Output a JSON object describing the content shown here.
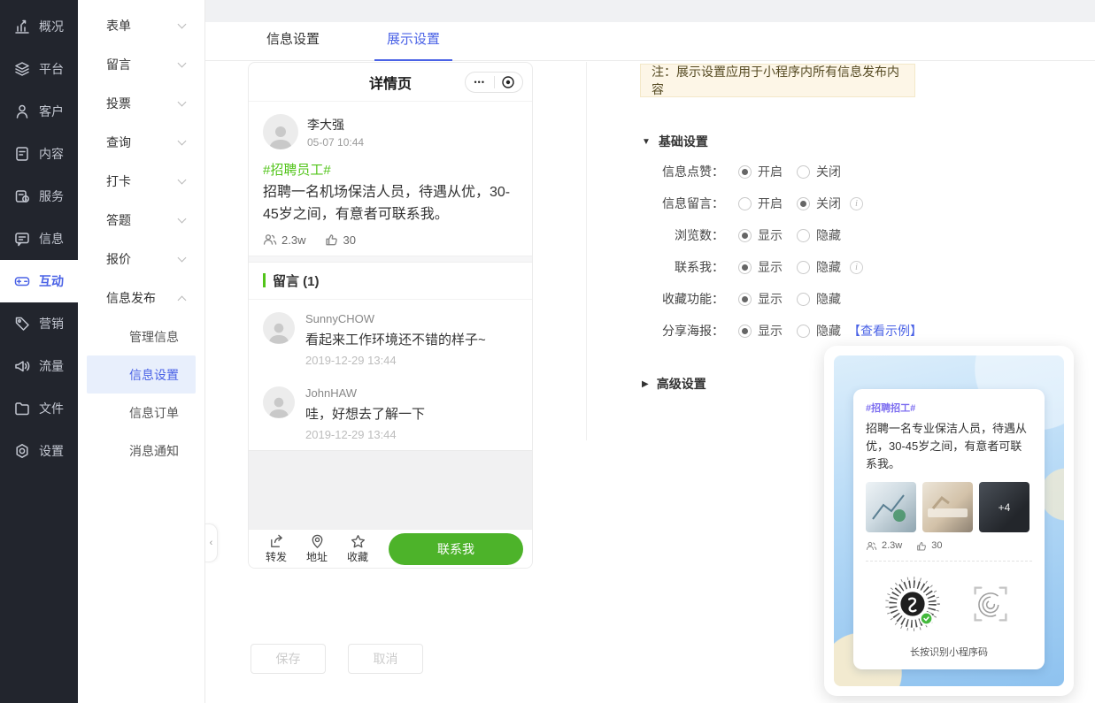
{
  "colors": {
    "accent": "#4a62e6",
    "wechat_green": "#4db32a",
    "tag_green": "#52c41a",
    "poster_purple": "#7d6ef0",
    "note_bg": "#fdf6e7"
  },
  "sidebar": {
    "items": [
      {
        "label": "概况",
        "icon": "overview-icon",
        "active": false
      },
      {
        "label": "平台",
        "icon": "platform-icon",
        "active": false
      },
      {
        "label": "客户",
        "icon": "customers-icon",
        "active": false
      },
      {
        "label": "内容",
        "icon": "content-icon",
        "active": false
      },
      {
        "label": "服务",
        "icon": "services-icon",
        "active": false
      },
      {
        "label": "信息",
        "icon": "messages-icon",
        "active": false
      },
      {
        "label": "互动",
        "icon": "interaction-icon",
        "active": true
      },
      {
        "label": "营销",
        "icon": "marketing-icon",
        "active": false
      },
      {
        "label": "流量",
        "icon": "traffic-icon",
        "active": false
      },
      {
        "label": "文件",
        "icon": "files-icon",
        "active": false
      },
      {
        "label": "设置",
        "icon": "settings-icon",
        "active": false
      }
    ]
  },
  "submenu": {
    "items": [
      {
        "label": "表单"
      },
      {
        "label": "留言"
      },
      {
        "label": "投票"
      },
      {
        "label": "查询"
      },
      {
        "label": "打卡"
      },
      {
        "label": "答题"
      },
      {
        "label": "报价"
      },
      {
        "label": "信息发布",
        "expanded": true
      }
    ],
    "children": [
      {
        "label": "管理信息",
        "selected": false
      },
      {
        "label": "信息设置",
        "selected": true
      },
      {
        "label": "信息订单",
        "selected": false
      },
      {
        "label": "消息通知",
        "selected": false
      }
    ]
  },
  "tabs": [
    {
      "label": "信息设置",
      "active": false
    },
    {
      "label": "展示设置",
      "active": true
    }
  ],
  "preview": {
    "title": "详情页",
    "capsule_dots": "•••",
    "post": {
      "name": "李大强",
      "time": "05-07 10:44",
      "tag": "#招聘员工#",
      "text": "招聘一名机场保洁人员，待遇从优，30-45岁之间，有意者可联系我。",
      "views": "2.3w",
      "likes": "30"
    },
    "comments_title": "留言 (1)",
    "comments": [
      {
        "name": "SunnyCHOW",
        "text": "看起来工作环境还不错的样子~",
        "time": "2019-12-29 13:44"
      },
      {
        "name": "JohnHAW",
        "text": "哇，好想去了解一下",
        "time": "2019-12-29 13:44"
      }
    ],
    "footer": {
      "actions": [
        {
          "label": "转发",
          "icon": "forward-icon"
        },
        {
          "label": "地址",
          "icon": "location-icon"
        },
        {
          "label": "收藏",
          "icon": "star-icon"
        }
      ],
      "contact_button": "联系我"
    }
  },
  "settings": {
    "note": "注：展示设置应用于小程序内所有信息发布内容",
    "basic_title": "基础设置",
    "advanced_title": "高级设置",
    "rows": [
      {
        "label": "信息点赞：",
        "options": [
          {
            "text": "开启",
            "selected": true
          },
          {
            "text": "关闭",
            "selected": false
          }
        ],
        "info": false
      },
      {
        "label": "信息留言：",
        "options": [
          {
            "text": "开启",
            "selected": false
          },
          {
            "text": "关闭",
            "selected": true
          }
        ],
        "info": true
      },
      {
        "label": "浏览数：",
        "options": [
          {
            "text": "显示",
            "selected": true
          },
          {
            "text": "隐藏",
            "selected": false
          }
        ],
        "info": false
      },
      {
        "label": "联系我：",
        "options": [
          {
            "text": "显示",
            "selected": true
          },
          {
            "text": "隐藏",
            "selected": false
          }
        ],
        "info": true
      },
      {
        "label": "收藏功能：",
        "options": [
          {
            "text": "显示",
            "selected": true
          },
          {
            "text": "隐藏",
            "selected": false
          }
        ],
        "info": false
      },
      {
        "label": "分享海报：",
        "options": [
          {
            "text": "显示",
            "selected": true
          },
          {
            "text": "隐藏",
            "selected": false
          }
        ],
        "info": false,
        "link": "【查看示例】"
      }
    ]
  },
  "poster": {
    "tag": "#招聘招工#",
    "text": "招聘一名专业保洁人员，待遇从优，30-45岁之间，有意者可联系我。",
    "more_badge": "+4",
    "views": "2.3w",
    "likes": "30",
    "caption": "长按识别小程序码"
  },
  "actions": {
    "save": "保存",
    "cancel": "取消"
  }
}
